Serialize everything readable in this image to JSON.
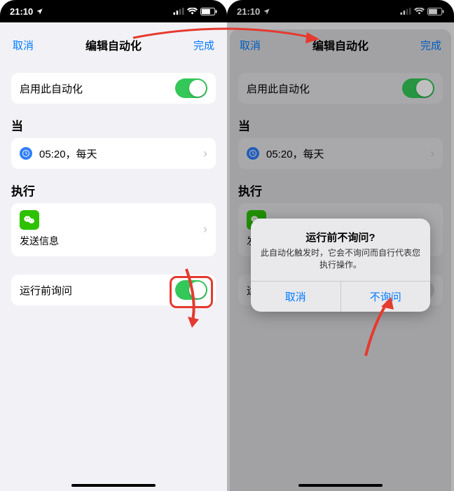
{
  "status": {
    "time": "21:10"
  },
  "nav": {
    "cancel": "取消",
    "title": "编辑自动化",
    "done": "完成"
  },
  "enable": {
    "label": "启用此自动化"
  },
  "when": {
    "header": "当",
    "time": "05:20，每天"
  },
  "do": {
    "header": "执行",
    "action": "发送信息"
  },
  "ask": {
    "label": "运行前询问"
  },
  "alert": {
    "title": "运行前不询问?",
    "message": "此自动化触发时，它会不询问而自行代表您执行操作。",
    "cancel": "取消",
    "confirm": "不询问"
  }
}
